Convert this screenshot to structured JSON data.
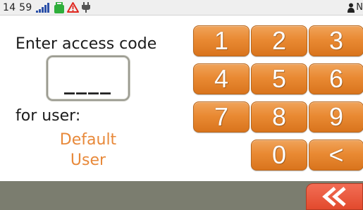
{
  "status_bar": {
    "time": "14 59",
    "icons": [
      "signal-bars-icon",
      "battery-icon",
      "warning-icon",
      "power-plug-icon"
    ],
    "right_text": "N",
    "right_icon": "person-icon"
  },
  "login": {
    "prompt": "Enter access code",
    "code_value": "____",
    "for_user_label": "for user:",
    "user_name_line1": "Default",
    "user_name_line2": "User"
  },
  "keypad": {
    "keys": [
      "1",
      "2",
      "3",
      "4",
      "5",
      "6",
      "7",
      "8",
      "9",
      "0",
      "<"
    ]
  },
  "footer": {
    "back_icon": "double-chevron-left-icon"
  },
  "colors": {
    "accent_orange": "#e98a33",
    "user_text": "#e8893a",
    "footer_bg": "#7b7d6f",
    "back_button": "#e24a2d"
  }
}
